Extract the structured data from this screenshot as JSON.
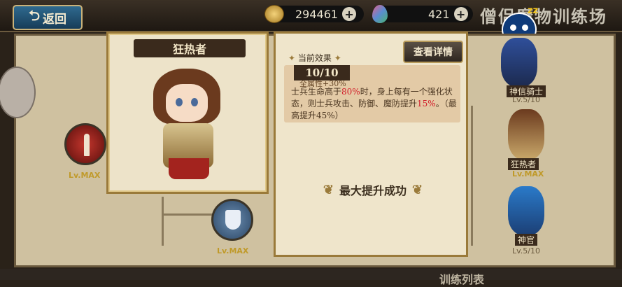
{
  "topbar": {
    "back_label": "返回",
    "gold": "294461",
    "gems": "421",
    "title": "僧侣魔物训练场",
    "sleep_mark": "zz"
  },
  "skills": {
    "left_node_level": "Lv.MAX",
    "bottom_node_level": "Lv.MAX"
  },
  "character": {
    "name": "狂热者"
  },
  "effect": {
    "header": "当前效果",
    "detail_button": "查看详情",
    "rank": "10/10",
    "cut_line": "全属性+30%",
    "desc_parts": [
      "士兵生命高于",
      "80%",
      "时，身上每有一个强化状态，则士兵攻击、防御、魔防提升",
      "15%",
      "。（最高提升45%）"
    ],
    "success_label": "最大提升成功"
  },
  "units": [
    {
      "name": "神信骑士",
      "level": "Lv.5/10"
    },
    {
      "name": "狂热者",
      "level": "Lv.MAX"
    },
    {
      "name": "神官",
      "level": "Lv.5/10"
    }
  ],
  "bottom": {
    "label": "训练列表"
  },
  "colors": {
    "accent_red": "#d21e2a",
    "max_gold": "#c09a2a"
  }
}
